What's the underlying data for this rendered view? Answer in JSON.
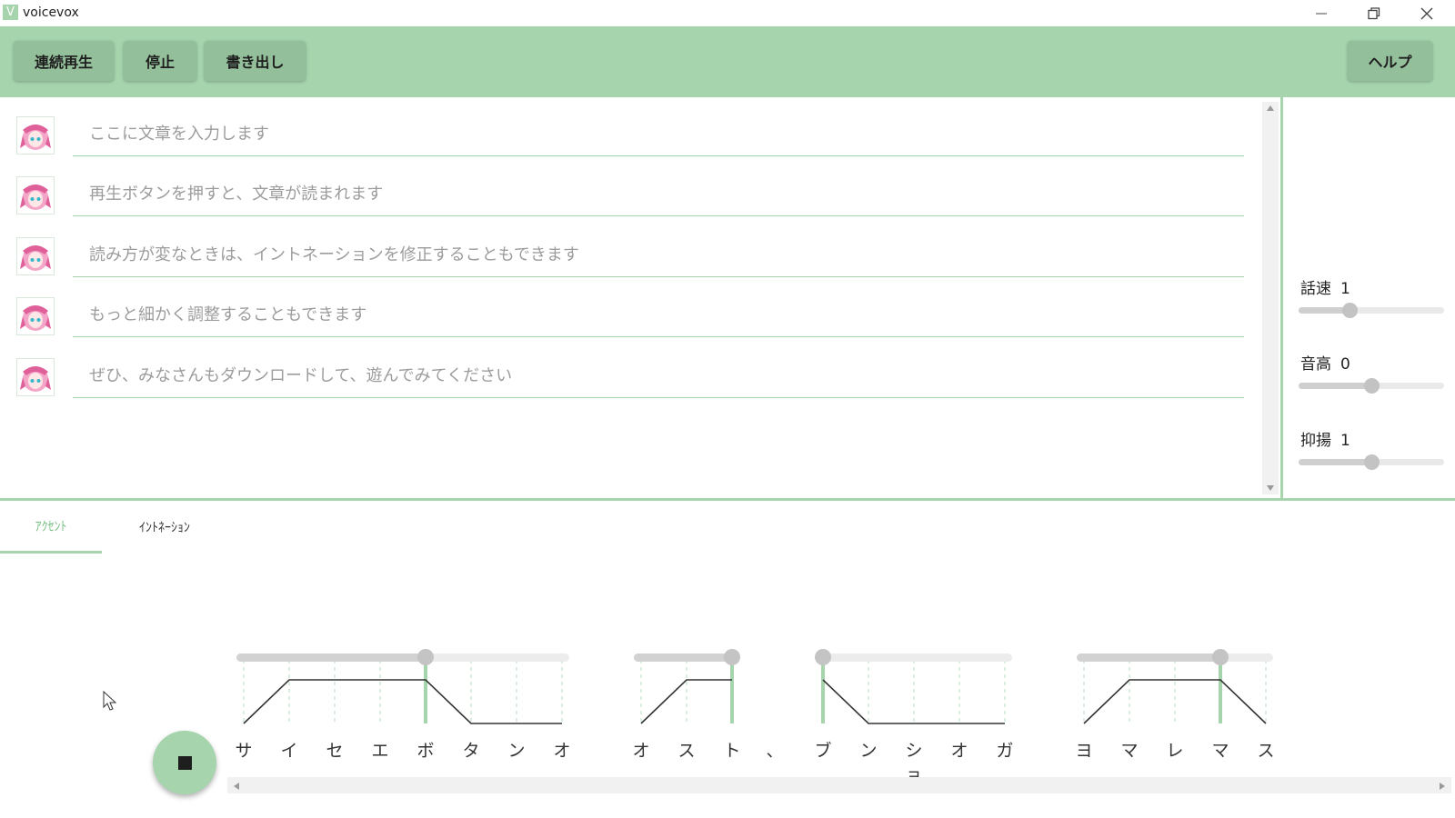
{
  "window": {
    "app_icon_letter": "V",
    "title": "voicevox"
  },
  "toolbar": {
    "continuous_play": "連続再生",
    "stop": "停止",
    "export": "書き出し",
    "help": "ヘルプ"
  },
  "text_rows": [
    {
      "placeholder": "ここに文章を入力します"
    },
    {
      "placeholder": "再生ボタンを押すと、文章が読まれます"
    },
    {
      "placeholder": "読み方が変なときは、イントネーションを修正することもできます"
    },
    {
      "placeholder": "もっと細かく調整することもできます"
    },
    {
      "placeholder": "ぜひ、みなさんもダウンロードして、遊んでみてください"
    }
  ],
  "params": {
    "speed": {
      "label": "話速",
      "value": "1",
      "level": 0.35
    },
    "pitch": {
      "label": "音高",
      "value": "0",
      "level": 0.5
    },
    "intonation": {
      "label": "抑揚",
      "value": "1",
      "level": 0.5
    }
  },
  "tabs": {
    "accent": "ｱｸｾﾝﾄ",
    "intonation": "ｲﾝﾄﾈｰｼｮﾝ"
  },
  "accent_phrases": [
    {
      "moras": [
        "サ",
        "イ",
        "セ",
        "エ",
        "ボ",
        "タ",
        "ン",
        "オ"
      ],
      "accent": 5
    },
    {
      "moras": [
        "オ",
        "ス",
        "ト"
      ],
      "accent": 3
    },
    {
      "moras": [
        "、"
      ],
      "accent": 0
    },
    {
      "moras": [
        "ブ",
        "ン",
        "ショ",
        "オ",
        "ガ"
      ],
      "accent": 1
    },
    {
      "moras": [
        "ヨ",
        "マ",
        "レ",
        "マ",
        "ス"
      ],
      "accent": 4
    }
  ],
  "colors": {
    "accent_green": "#a5d4ad",
    "button_green": "#94bf9b"
  },
  "icons": {
    "minimize": "minimize-icon",
    "restore": "restore-icon",
    "close": "close-icon",
    "stop": "stop-icon",
    "scroll_up": "arrow-up-icon",
    "scroll_down": "arrow-down-icon",
    "scroll_left": "arrow-left-icon",
    "scroll_right": "arrow-right-icon"
  }
}
